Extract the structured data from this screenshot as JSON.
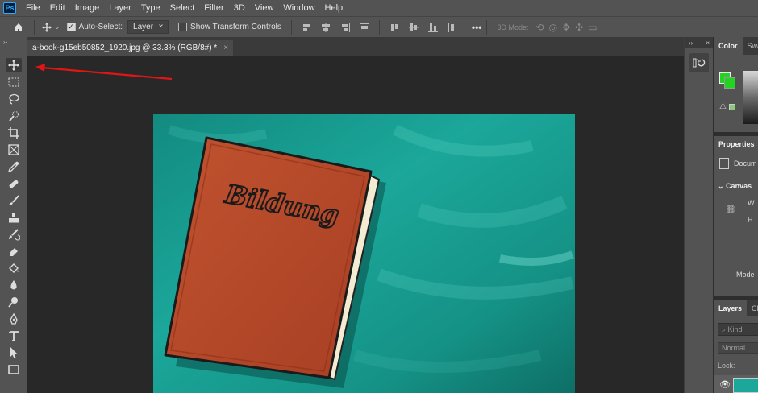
{
  "app": {
    "logo": "Ps"
  },
  "menu": [
    "File",
    "Edit",
    "Image",
    "Layer",
    "Type",
    "Select",
    "Filter",
    "3D",
    "View",
    "Window",
    "Help"
  ],
  "options": {
    "auto_select_label": "Auto-Select:",
    "auto_select_checked": true,
    "layer_dropdown": "Layer",
    "show_transform_label": "Show Transform Controls",
    "show_transform_checked": false,
    "mode3d_label": "3D Mode:",
    "more": "•••"
  },
  "document": {
    "tab_title": "a-book-g15eb50852_1920.jpg @ 33.3% (RGB/8#) *",
    "close": "×"
  },
  "canvas_image": {
    "book_title": "Bildung",
    "background_color": "#1ba79a",
    "book_color": "#b5492b"
  },
  "panels": {
    "color_tab": "Color",
    "swatches_tab": "Swa",
    "foreground_color": "#22d322",
    "properties_tab": "Properties",
    "document_label": "Docum",
    "canvas_section": "Canvas",
    "width_label": "W",
    "height_label": "H",
    "mode_label": "Mode",
    "layers_tab": "Layers",
    "channels_tab": "Ch",
    "kind_placeholder": "Kind",
    "blend_mode": "Normal",
    "lock_label": "Lock:"
  },
  "toolbar": {
    "tools": [
      "move-tool",
      "marquee-tool",
      "lasso-tool",
      "quick-selection-tool",
      "crop-tool",
      "frame-tool",
      "eyedropper-tool",
      "healing-brush-tool",
      "brush-tool",
      "clone-stamp-tool",
      "history-brush-tool",
      "eraser-tool",
      "paint-bucket-tool",
      "blur-tool",
      "dodge-tool",
      "pen-tool",
      "type-tool",
      "path-selection-tool",
      "rectangle-tool"
    ],
    "selected": "move-tool"
  },
  "annotation": {
    "color": "#e01515"
  }
}
